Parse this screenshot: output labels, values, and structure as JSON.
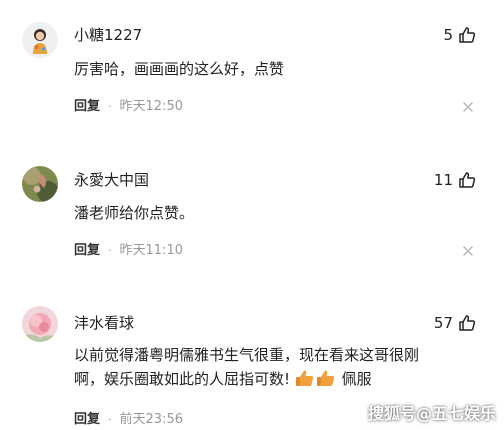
{
  "comments": [
    {
      "username": "小糖1227",
      "likes": "5",
      "text": "厉害哈，画画画的这么好，点赞",
      "reply_label": "回复",
      "time": "昨天12:50"
    },
    {
      "username": "永愛大中国",
      "likes": "11",
      "text": "潘老师给你点赞。",
      "reply_label": "回复",
      "time": "昨天11:10"
    },
    {
      "username": "沣水看球",
      "likes": "57",
      "text_line1": "以前觉得潘粤明儒雅书生气很重，现在看来这哥很刚",
      "text_line2": "啊，娱乐圈敢如此的人屈指可数!",
      "text_tail": "佩服",
      "reply_label": "回复",
      "time": "前天23:56"
    }
  ],
  "separator": "·",
  "watermark": "搜狐号@五七娱乐",
  "icons": {
    "like": "thumbs-up-outline-icon",
    "delete": "close-icon",
    "emoji": "thumbs-up-emoji-icon"
  },
  "colors": {
    "text": "#222222",
    "meta": "#999999",
    "emoji": "#f2a03d"
  }
}
